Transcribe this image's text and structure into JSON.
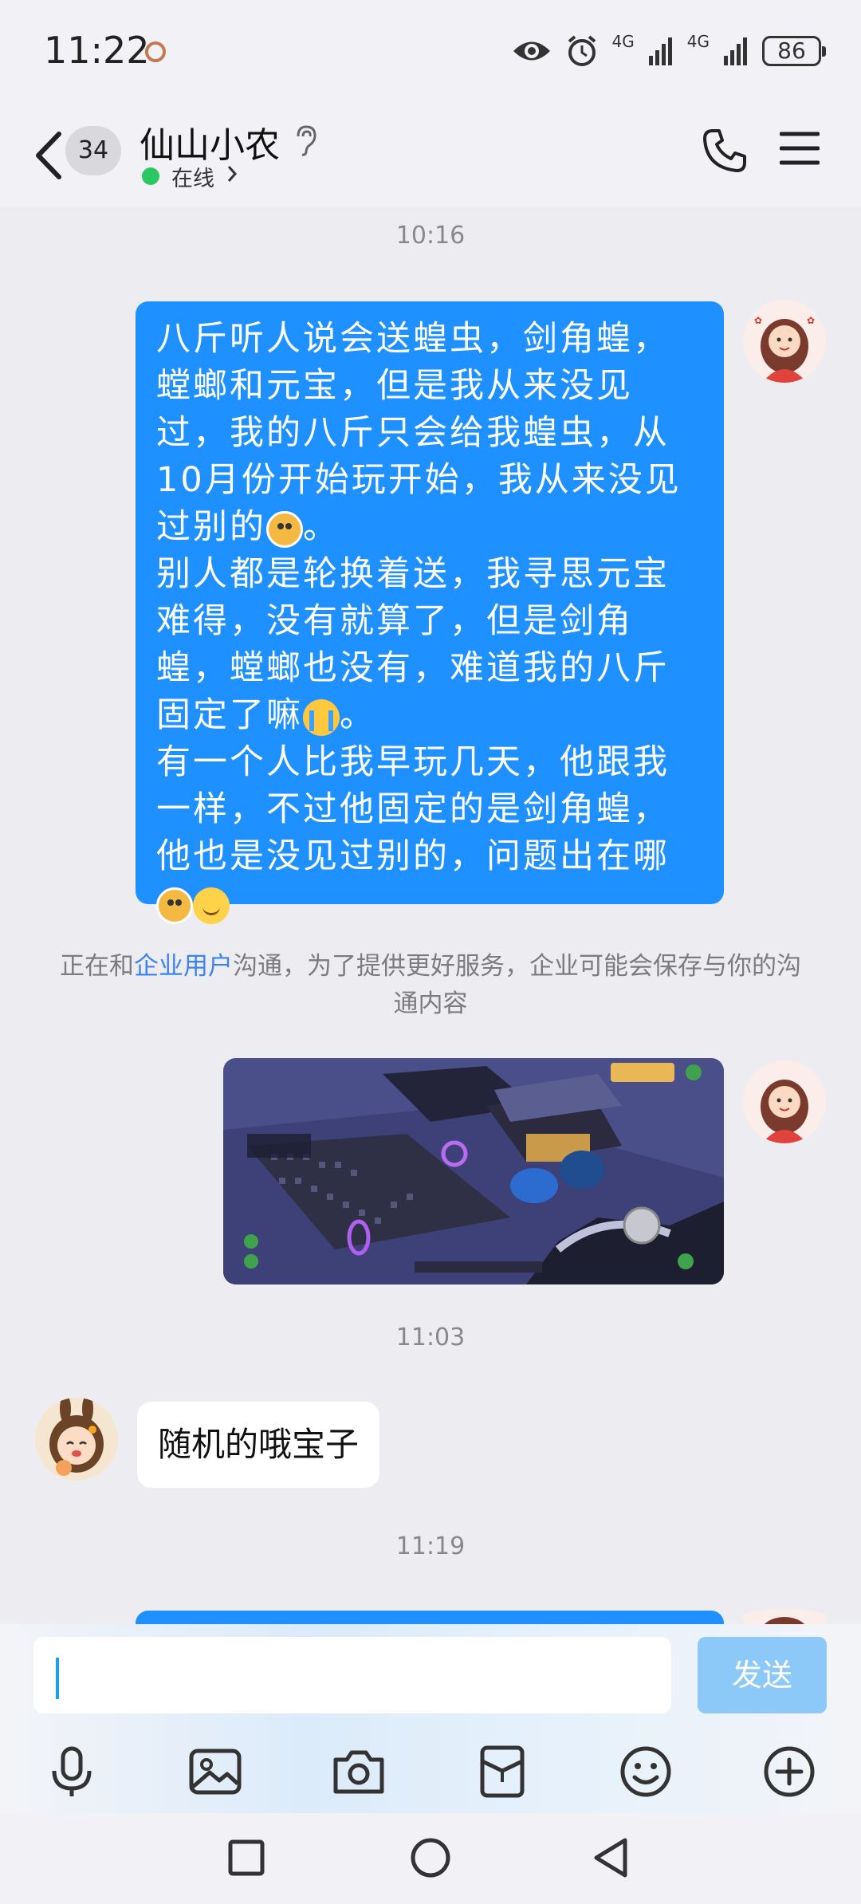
{
  "status_bar": {
    "time": "11:22",
    "network_1": "4G",
    "network_2": "4G",
    "battery": "86"
  },
  "header": {
    "unread_count": "34",
    "contact_name": "仙山小农",
    "status": "在线"
  },
  "messages": {
    "timestamp_1": "10:16",
    "outgoing_1_part1": "八斤听人说会送蝗虫，剑角蝗，螳螂和元宝，但是我从来没见过，我的八斤只会给我蝗虫，从10月份开始玩开始，我从来没见过别的",
    "outgoing_1_part1_end": "。",
    "outgoing_1_part2": "别人都是轮换着送，我寻思元宝难得，没有就算了，但是剑角蝗，螳螂也没有，难道我的八斤固定了嘛",
    "outgoing_1_part2_end": "。",
    "outgoing_1_part3": "有一个人比我早玩几天，他跟我一样，不过他固定的是剑角蝗，他也是没见过别的，问题出在哪",
    "notice_prefix": "正在和",
    "notice_link": "企业用户",
    "notice_suffix": "沟通，为了提供更好服务，企业可能会保存与你的沟通内容",
    "timestamp_2": "11:03",
    "incoming_1": "随机的哦宝子",
    "timestamp_3": "11:19"
  },
  "input": {
    "value": "",
    "send_label": "发送"
  },
  "colors": {
    "bubble_out": "#1E90FF",
    "online": "#2BC760",
    "send_disabled": "#8CC8F8",
    "link": "#3B82F6"
  }
}
